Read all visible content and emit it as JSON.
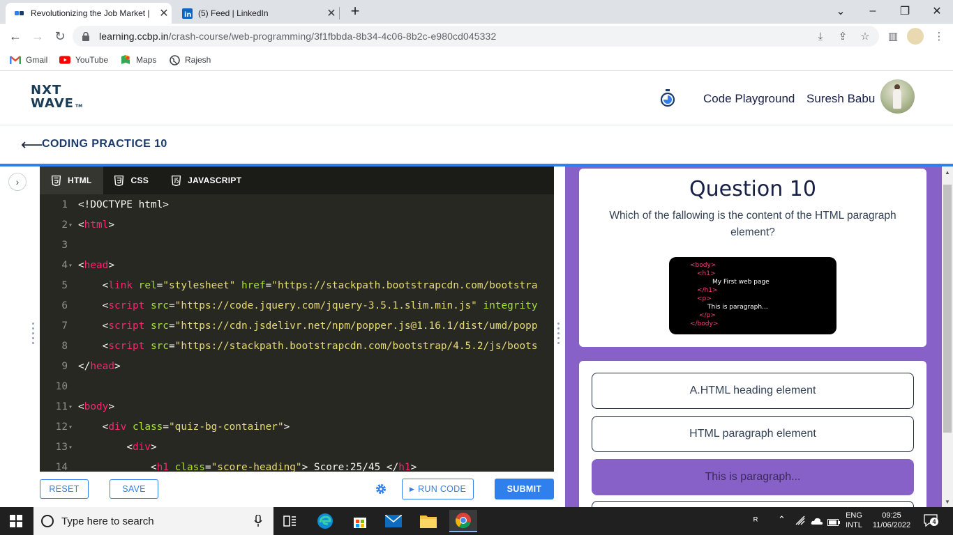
{
  "browser": {
    "tabs": [
      {
        "title": "Revolutionizing the Job Market |",
        "active": true
      },
      {
        "title": "(5) Feed | LinkedIn",
        "active": false
      }
    ],
    "new_tab": "+",
    "url_host": "learning.ccbp.in",
    "url_path": "/crash-course/web-programming/3f1fbbda-8b34-4c06-8b2c-e980cd045332",
    "bookmarks": [
      {
        "label": "Gmail",
        "icon": "gmail-icon"
      },
      {
        "label": "YouTube",
        "icon": "youtube-icon"
      },
      {
        "label": "Maps",
        "icon": "maps-icon"
      },
      {
        "label": "Rajesh",
        "icon": "globe-icon"
      }
    ]
  },
  "header": {
    "logo_line1": "NXT",
    "logo_line2": "WAVE",
    "logo_tm": "TM",
    "code_playground": "Code Playground",
    "user_name": "Suresh Babu"
  },
  "practice": {
    "title": "CODING PRACTICE 10"
  },
  "editor": {
    "tabs": [
      "HTML",
      "CSS",
      "JAVASCRIPT"
    ],
    "active_tab": "HTML",
    "lines": [
      {
        "n": "1",
        "fold": false,
        "indent": "",
        "segs": [
          [
            "p",
            "<!DOCTYPE html>"
          ]
        ]
      },
      {
        "n": "2",
        "fold": true,
        "indent": "",
        "segs": [
          [
            "p",
            "<"
          ],
          [
            "t",
            "html"
          ],
          [
            "p",
            ">"
          ]
        ]
      },
      {
        "n": "3",
        "fold": false,
        "indent": "",
        "segs": []
      },
      {
        "n": "4",
        "fold": true,
        "indent": "",
        "segs": [
          [
            "p",
            "<"
          ],
          [
            "t",
            "head"
          ],
          [
            "p",
            ">"
          ]
        ]
      },
      {
        "n": "5",
        "fold": false,
        "indent": "    ",
        "segs": [
          [
            "p",
            "<"
          ],
          [
            "t",
            "link"
          ],
          [
            "p",
            " "
          ],
          [
            "a",
            "rel"
          ],
          [
            "p",
            "="
          ],
          [
            "s",
            "\"stylesheet\""
          ],
          [
            "p",
            " "
          ],
          [
            "a",
            "href"
          ],
          [
            "p",
            "="
          ],
          [
            "s",
            "\"https://stackpath.bootstrapcdn.com/bootstra"
          ]
        ]
      },
      {
        "n": "6",
        "fold": false,
        "indent": "    ",
        "segs": [
          [
            "p",
            "<"
          ],
          [
            "t",
            "script"
          ],
          [
            "p",
            " "
          ],
          [
            "a",
            "src"
          ],
          [
            "p",
            "="
          ],
          [
            "s",
            "\"https://code.jquery.com/jquery-3.5.1.slim.min.js\""
          ],
          [
            "p",
            " "
          ],
          [
            "a",
            "integrity"
          ]
        ]
      },
      {
        "n": "7",
        "fold": false,
        "indent": "    ",
        "segs": [
          [
            "p",
            "<"
          ],
          [
            "t",
            "script"
          ],
          [
            "p",
            " "
          ],
          [
            "a",
            "src"
          ],
          [
            "p",
            "="
          ],
          [
            "s",
            "\"https://cdn.jsdelivr.net/npm/popper.js@1.16.1/dist/umd/popp"
          ]
        ]
      },
      {
        "n": "8",
        "fold": false,
        "indent": "    ",
        "segs": [
          [
            "p",
            "<"
          ],
          [
            "t",
            "script"
          ],
          [
            "p",
            " "
          ],
          [
            "a",
            "src"
          ],
          [
            "p",
            "="
          ],
          [
            "s",
            "\"https://stackpath.bootstrapcdn.com/bootstrap/4.5.2/js/boots"
          ]
        ]
      },
      {
        "n": "9",
        "fold": false,
        "indent": "",
        "segs": [
          [
            "p",
            "</"
          ],
          [
            "t",
            "head"
          ],
          [
            "p",
            ">"
          ]
        ]
      },
      {
        "n": "10",
        "fold": false,
        "indent": "",
        "segs": []
      },
      {
        "n": "11",
        "fold": true,
        "indent": "",
        "segs": [
          [
            "p",
            "<"
          ],
          [
            "t",
            "body"
          ],
          [
            "p",
            ">"
          ]
        ]
      },
      {
        "n": "12",
        "fold": true,
        "indent": "    ",
        "segs": [
          [
            "p",
            "<"
          ],
          [
            "t",
            "div"
          ],
          [
            "p",
            " "
          ],
          [
            "a",
            "class"
          ],
          [
            "p",
            "="
          ],
          [
            "s",
            "\"quiz-bg-container\""
          ],
          [
            "p",
            ">"
          ]
        ]
      },
      {
        "n": "13",
        "fold": true,
        "indent": "        ",
        "segs": [
          [
            "p",
            "<"
          ],
          [
            "t",
            "div"
          ],
          [
            "p",
            ">"
          ]
        ]
      },
      {
        "n": "14",
        "fold": false,
        "indent": "            ",
        "segs": [
          [
            "p",
            "<"
          ],
          [
            "t",
            "h1"
          ],
          [
            "p",
            " "
          ],
          [
            "a",
            "class"
          ],
          [
            "p",
            "="
          ],
          [
            "s",
            "\"score-heading\""
          ],
          [
            "p",
            "> Score:25/45 </"
          ],
          [
            "t",
            "h1"
          ],
          [
            "p",
            ">"
          ]
        ]
      }
    ]
  },
  "footer_buttons": {
    "reset": "RESET",
    "save": "SAVE",
    "run": "RUN CODE",
    "submit": "SUBMIT"
  },
  "question": {
    "title": "Question 10",
    "text": "Which of the fallowing is the content of the HTML paragraph element?",
    "image_lines": [
      {
        "tag": true,
        "text": "<body>"
      },
      {
        "tag": true,
        "text": "<h1>"
      },
      {
        "tag": false,
        "text": "My First web page"
      },
      {
        "tag": true,
        "text": "</h1>"
      },
      {
        "tag": true,
        "text": "<p>"
      },
      {
        "tag": false,
        "text": "This is paragraph..."
      },
      {
        "tag": true,
        "text": "</p>"
      },
      {
        "tag": true,
        "text": "</body>"
      }
    ],
    "options": [
      {
        "label": "A.HTML heading element",
        "selected": false
      },
      {
        "label": "HTML paragraph element",
        "selected": false
      },
      {
        "label": "This is paragraph...",
        "selected": true
      }
    ]
  },
  "taskbar": {
    "search_placeholder": "Type here to search",
    "lang_line1": "ENG",
    "lang_line2": "INTL",
    "time": "09:25",
    "date": "11/06/2022",
    "notifications": "4"
  },
  "colors": {
    "accent_blue": "#2f80ed",
    "purple": "#8861c8",
    "editor_bg": "#272822"
  }
}
